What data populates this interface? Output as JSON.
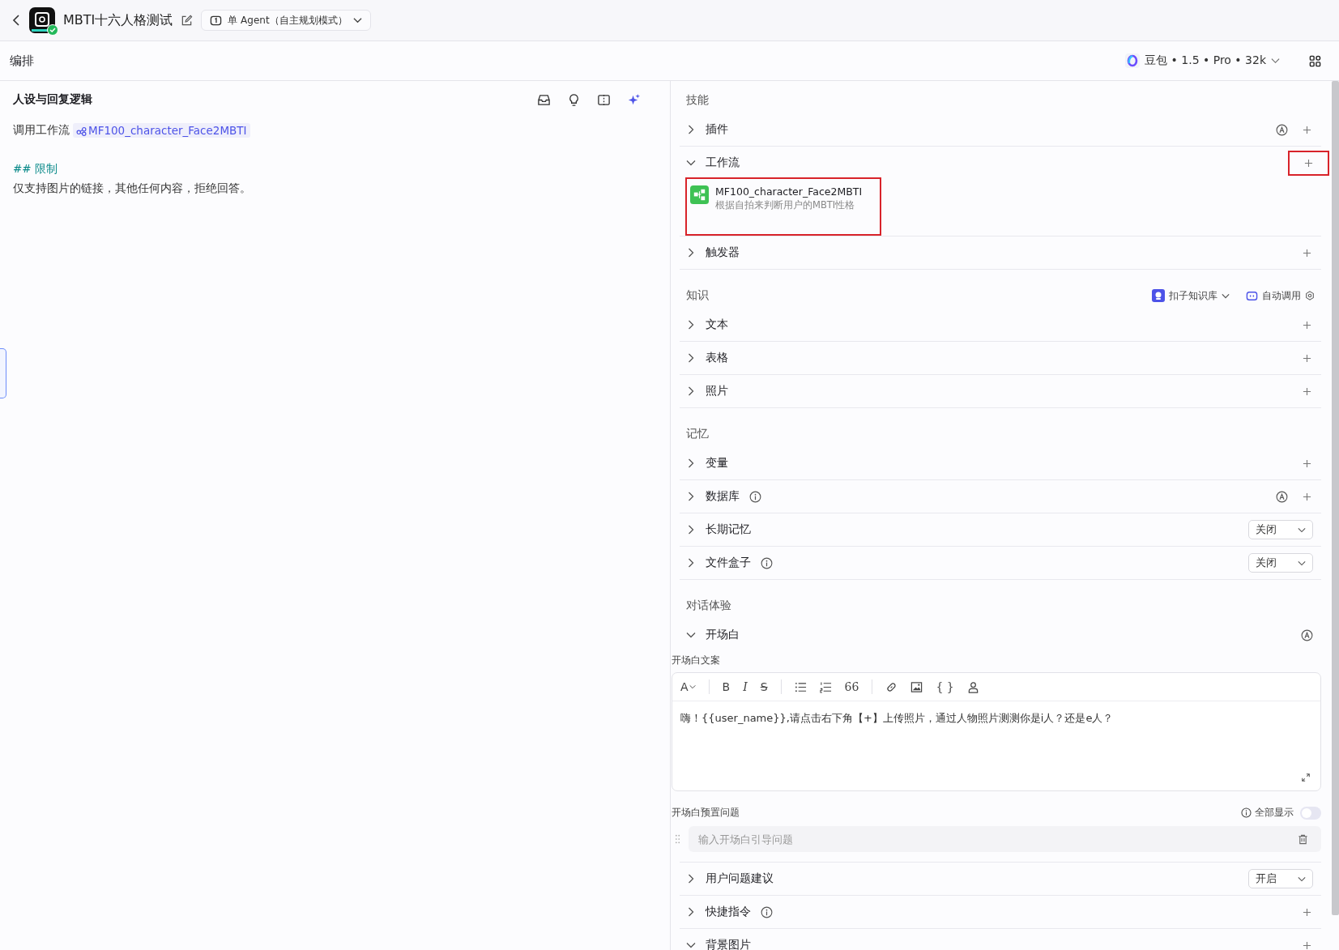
{
  "header": {
    "title": "MBTI十六人格测试",
    "verified": true,
    "mode": "单 Agent（自主规划模式）"
  },
  "toolbar": {
    "title": "编排",
    "model": "豆包 • 1.5 • Pro • 32k"
  },
  "prompt": {
    "title": "人设与回复逻辑",
    "lines": [
      {
        "kind": "call",
        "text": "调用工作流",
        "link": "MF100_character_Face2MBTI"
      },
      {
        "kind": "blank"
      },
      {
        "kind": "heading",
        "text": "## 限制"
      },
      {
        "kind": "text",
        "text": "仅支持图片的链接，其他任何内容，拒绝回答。"
      }
    ]
  },
  "sections": [
    {
      "title": "技能",
      "rows": [
        {
          "label": "插件",
          "expanded": false,
          "info": false,
          "auto": true,
          "add": true,
          "add_highlighted": false
        },
        {
          "label": "工作流",
          "expanded": true,
          "info": false,
          "auto": false,
          "add": true,
          "add_highlighted": true,
          "items": [
            {
              "name": "MF100_character_Face2MBTI",
              "description": "根据自拍来判断用户的MBTI性格",
              "highlighted": true
            }
          ]
        },
        {
          "label": "触发器",
          "expanded": false,
          "info": false,
          "auto": false,
          "add": true,
          "add_highlighted": false
        }
      ]
    },
    {
      "title": "知识",
      "source": "扣子知识库",
      "mode": "自动调用",
      "rows": [
        {
          "label": "文本",
          "expanded": false,
          "info": false,
          "auto": false,
          "add": true,
          "add_highlighted": false
        },
        {
          "label": "表格",
          "expanded": false,
          "info": false,
          "auto": false,
          "add": true,
          "add_highlighted": false
        },
        {
          "label": "照片",
          "expanded": false,
          "info": false,
          "auto": false,
          "add": true,
          "add_highlighted": false
        }
      ]
    },
    {
      "title": "记忆",
      "rows": [
        {
          "label": "变量",
          "expanded": false,
          "info": false,
          "auto": false,
          "add": true,
          "add_highlighted": false
        },
        {
          "label": "数据库",
          "expanded": false,
          "info": true,
          "auto": true,
          "add": true,
          "add_highlighted": false
        },
        {
          "label": "长期记忆",
          "expanded": false,
          "info": false,
          "auto": false,
          "add": false,
          "add_highlighted": false,
          "select": "关闭"
        },
        {
          "label": "文件盒子",
          "expanded": false,
          "info": true,
          "auto": false,
          "add": false,
          "add_highlighted": false,
          "select": "关闭"
        }
      ]
    },
    {
      "title": "对话体验",
      "rows": [
        {
          "label": "开场白",
          "expanded": true,
          "info": false,
          "auto": true,
          "add": false,
          "add_highlighted": false,
          "opening": {
            "label": "开场白文案",
            "text": "嗨！{{user_name}},请点击右下角【+】上传照片，通过人物照片测测你是i人？还是e人？",
            "questions_label": "开场白预置问题",
            "show_all": "全部显示",
            "show_all_on": false,
            "placeholder": "输入开场白引导问题"
          }
        },
        {
          "label": "用户问题建议",
          "expanded": false,
          "info": false,
          "auto": false,
          "add": false,
          "add_highlighted": false,
          "select": "开启"
        },
        {
          "label": "快捷指令",
          "expanded": false,
          "info": true,
          "auto": false,
          "add": true,
          "add_highlighted": false
        },
        {
          "label": "背景图片",
          "expanded": true,
          "info": false,
          "auto": false,
          "add": true,
          "add_highlighted": false
        }
      ]
    }
  ],
  "editor_tools": [
    {
      "kind": "font",
      "glyph": "A"
    },
    {
      "kind": "divider"
    },
    {
      "kind": "bold",
      "glyph": "B"
    },
    {
      "kind": "italic",
      "glyph": "I"
    },
    {
      "kind": "strike",
      "glyph": "S"
    },
    {
      "kind": "divider"
    },
    {
      "kind": "bullets"
    },
    {
      "kind": "numbers"
    },
    {
      "kind": "quote",
      "glyph": "66"
    },
    {
      "kind": "divider"
    },
    {
      "kind": "link"
    },
    {
      "kind": "image"
    },
    {
      "kind": "braces",
      "glyph": "{ }"
    },
    {
      "kind": "person"
    }
  ]
}
